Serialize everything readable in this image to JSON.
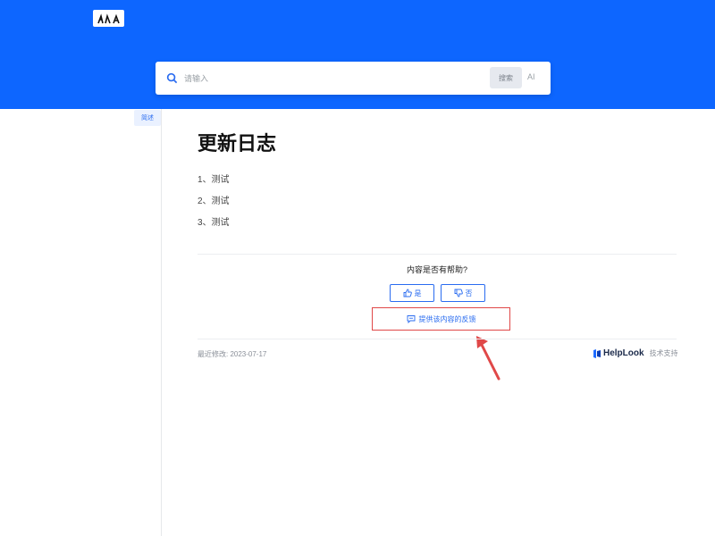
{
  "header": {
    "bg_color": "#0d66ff"
  },
  "logo": {
    "icon": "logo-icon"
  },
  "search": {
    "placeholder": "请输入",
    "button_label": "搜索",
    "ai_label": "AI"
  },
  "sidebar": {
    "items": [
      {
        "label": "简述"
      }
    ]
  },
  "article": {
    "title": "更新日志",
    "items": [
      "1、测试",
      "2、测试",
      "3、测试"
    ]
  },
  "feedback": {
    "question": "内容是否有帮助?",
    "yes_label": "是",
    "no_label": "否",
    "link_label": "提供该内容的反馈"
  },
  "footer": {
    "last_modified": "最近修改: 2023-07-17",
    "brand": "HelpLook",
    "support": "技术支持"
  },
  "colors": {
    "accent": "#2a6cf0",
    "annotation_red": "#e04848"
  }
}
